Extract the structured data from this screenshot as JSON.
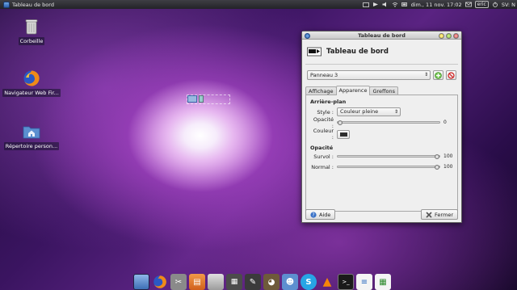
{
  "top_panel": {
    "window_title": "Tableau de bord",
    "datetime": "dim., 11 nov.  17:02",
    "user": "eric",
    "keyboard": "SV: N"
  },
  "desktop": {
    "icons": [
      {
        "label": "Corbeille",
        "icon": "trash-icon"
      },
      {
        "label": "Navigateur Web Fir...",
        "icon": "firefox-icon"
      },
      {
        "label": "Répertoire person...",
        "icon": "home-folder-icon"
      }
    ]
  },
  "window": {
    "title": "Tableau de bord",
    "header_title": "Tableau de bord",
    "panel_select": "Panneau 3",
    "tabs": [
      {
        "label": "Affichage",
        "active": false
      },
      {
        "label": "Apparence",
        "active": true
      },
      {
        "label": "Greffons",
        "active": false
      }
    ],
    "background_section": {
      "title": "Arrière-plan",
      "style_label": "Style :",
      "style_value": "Couleur pleine",
      "opacity_label": "Opacité :",
      "opacity_value": "0",
      "opacity_fraction": 0,
      "color_label": "Couleur :",
      "color_value": "#2d2d2d"
    },
    "opacity_section": {
      "title": "Opacité",
      "hover_label": "Survol :",
      "hover_value": "100",
      "hover_fraction": 1.0,
      "normal_label": "Normal :",
      "normal_value": "100",
      "normal_fraction": 1.0
    },
    "help_button": "Aide",
    "close_button": "Fermer"
  },
  "dock": {
    "items": [
      "desktop-icon",
      "firefox-icon",
      "settings-icon",
      "files-icon",
      "trash-icon",
      "calculator-icon",
      "tools-icon",
      "gimp-icon",
      "users-icon",
      "skype-icon",
      "vlc-icon",
      "terminal-icon",
      "writer-icon",
      "calc-icon"
    ]
  },
  "colors": {
    "accent": "#2a5eaa",
    "wallpaper": "#5a2382"
  }
}
